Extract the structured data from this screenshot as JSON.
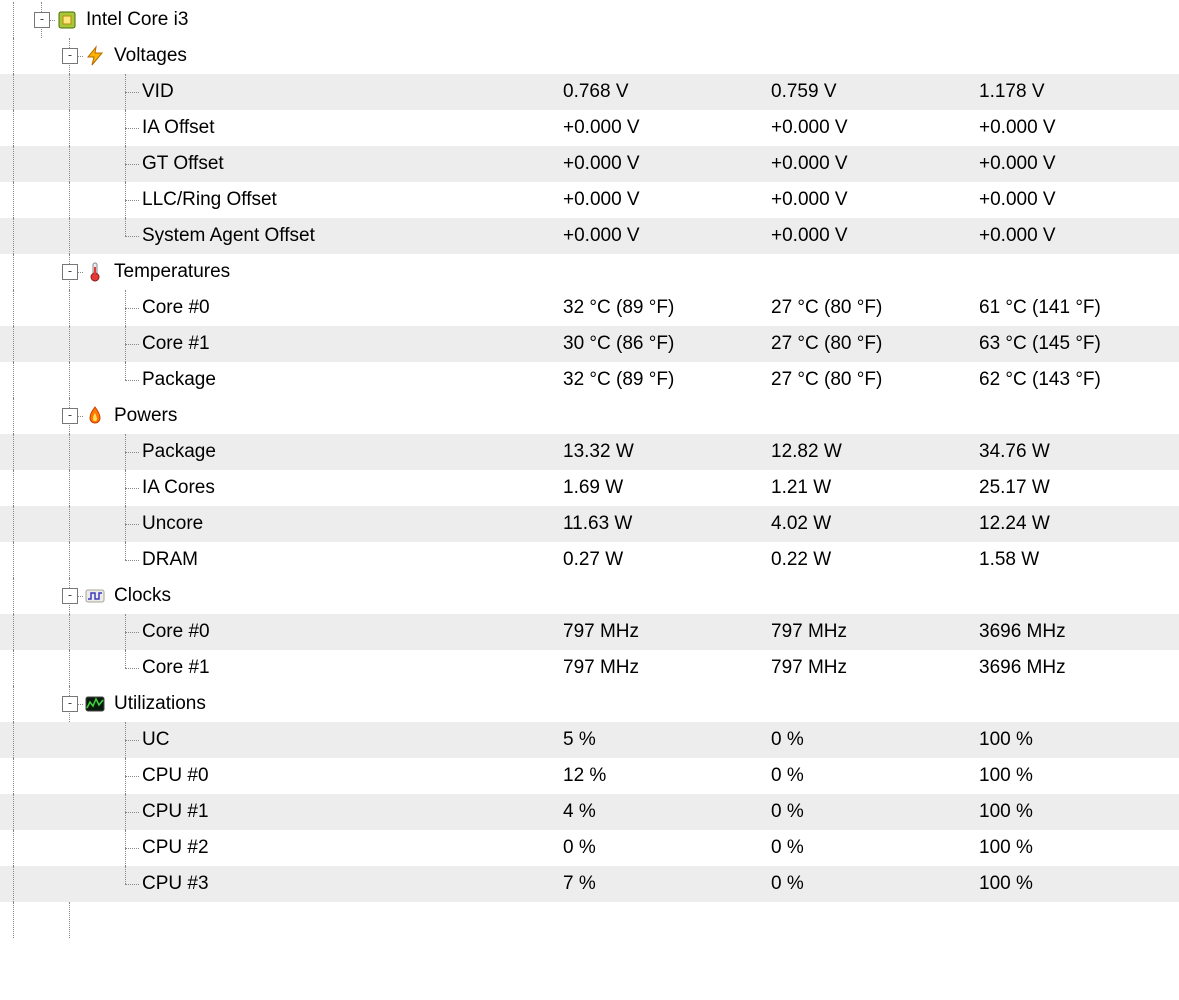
{
  "root": {
    "label": "Intel Core i3",
    "icon": "chip"
  },
  "sections": [
    {
      "label": "Voltages",
      "icon": "bolt",
      "rows": [
        {
          "label": "VID",
          "v": [
            "0.768 V",
            "0.759 V",
            "1.178 V"
          ]
        },
        {
          "label": "IA Offset",
          "v": [
            "+0.000 V",
            "+0.000 V",
            "+0.000 V"
          ]
        },
        {
          "label": "GT Offset",
          "v": [
            "+0.000 V",
            "+0.000 V",
            "+0.000 V"
          ]
        },
        {
          "label": "LLC/Ring Offset",
          "v": [
            "+0.000 V",
            "+0.000 V",
            "+0.000 V"
          ]
        },
        {
          "label": "System Agent Offset",
          "v": [
            "+0.000 V",
            "+0.000 V",
            "+0.000 V"
          ]
        }
      ]
    },
    {
      "label": "Temperatures",
      "icon": "thermo",
      "rows": [
        {
          "label": "Core #0",
          "v": [
            "32 °C  (89 °F)",
            "27 °C  (80 °F)",
            "61 °C  (141 °F)"
          ]
        },
        {
          "label": "Core #1",
          "v": [
            "30 °C  (86 °F)",
            "27 °C  (80 °F)",
            "63 °C  (145 °F)"
          ]
        },
        {
          "label": "Package",
          "v": [
            "32 °C  (89 °F)",
            "27 °C  (80 °F)",
            "62 °C  (143 °F)"
          ]
        }
      ]
    },
    {
      "label": "Powers",
      "icon": "flame",
      "rows": [
        {
          "label": "Package",
          "v": [
            "13.32 W",
            "12.82 W",
            "34.76 W"
          ]
        },
        {
          "label": "IA Cores",
          "v": [
            "1.69 W",
            "1.21 W",
            "25.17 W"
          ]
        },
        {
          "label": "Uncore",
          "v": [
            "11.63 W",
            "4.02 W",
            "12.24 W"
          ]
        },
        {
          "label": "DRAM",
          "v": [
            "0.27 W",
            "0.22 W",
            "1.58 W"
          ]
        }
      ]
    },
    {
      "label": "Clocks",
      "icon": "clock",
      "rows": [
        {
          "label": "Core #0",
          "v": [
            "797 MHz",
            "797 MHz",
            "3696 MHz"
          ]
        },
        {
          "label": "Core #1",
          "v": [
            "797 MHz",
            "797 MHz",
            "3696 MHz"
          ]
        }
      ]
    },
    {
      "label": "Utilizations",
      "icon": "util",
      "rows": [
        {
          "label": "UC",
          "v": [
            "5 %",
            "0 %",
            "100 %"
          ]
        },
        {
          "label": "CPU #0",
          "v": [
            "12 %",
            "0 %",
            "100 %"
          ]
        },
        {
          "label": "CPU #1",
          "v": [
            "4 %",
            "0 %",
            "100 %"
          ]
        },
        {
          "label": "CPU #2",
          "v": [
            "0 %",
            "0 %",
            "100 %"
          ]
        },
        {
          "label": "CPU #3",
          "v": [
            "7 %",
            "0 %",
            "100 %"
          ]
        }
      ]
    }
  ]
}
